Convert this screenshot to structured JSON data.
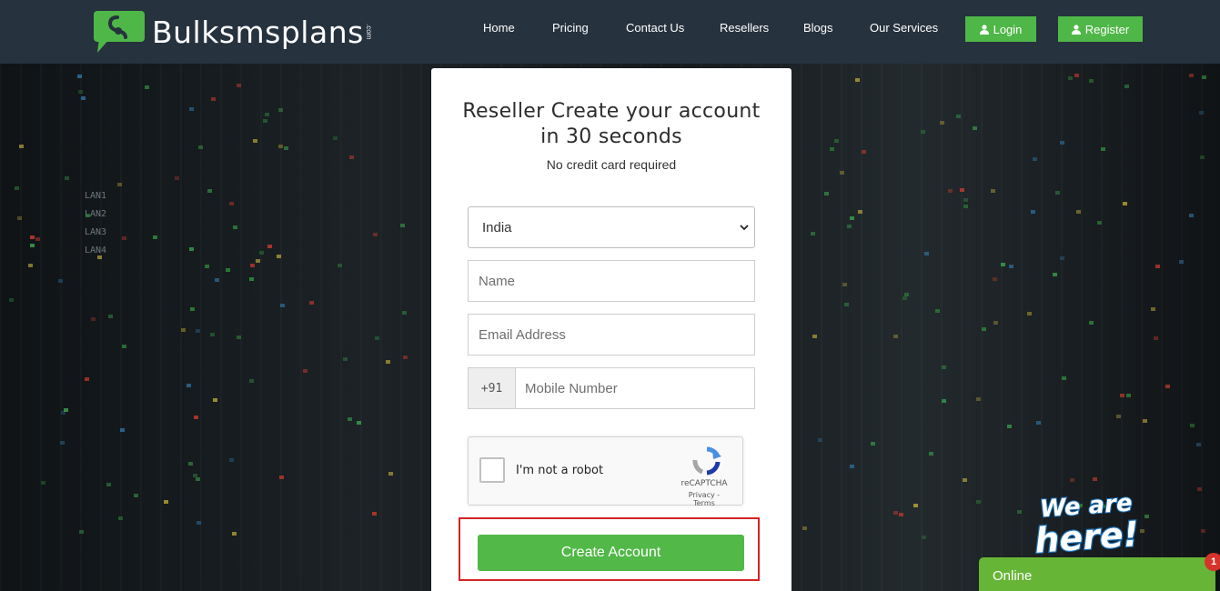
{
  "header": {
    "brand": "Bulksmsplans",
    "brand_suffix": ".com",
    "nav": [
      "Home",
      "Pricing",
      "Contact Us",
      "Resellers",
      "Blogs",
      "Our Services"
    ],
    "login_label": "Login",
    "register_label": "Register"
  },
  "background": {
    "rack_labels": [
      "LAN1",
      "LAN2",
      "LAN3",
      "LAN4"
    ]
  },
  "form": {
    "title_line1": "Reseller Create your account",
    "title_line2": "in 30 seconds",
    "subtitle": "No credit card required",
    "country_selected": "India",
    "name_placeholder": "Name",
    "email_placeholder": "Email Address",
    "phone_prefix": "+91",
    "mobile_placeholder": "Mobile Number",
    "captcha_label": "I'm not a robot",
    "captcha_brand": "reCAPTCHA",
    "captcha_terms": "Privacy - Terms",
    "submit_label": "Create Account"
  },
  "chat": {
    "banner": "We are here!",
    "status": "Online",
    "unread_count": "1"
  },
  "colors": {
    "header_bg": "#26323e",
    "accent_green": "#4fb748",
    "highlight_red": "#d32424",
    "chat_green": "#67b536"
  }
}
